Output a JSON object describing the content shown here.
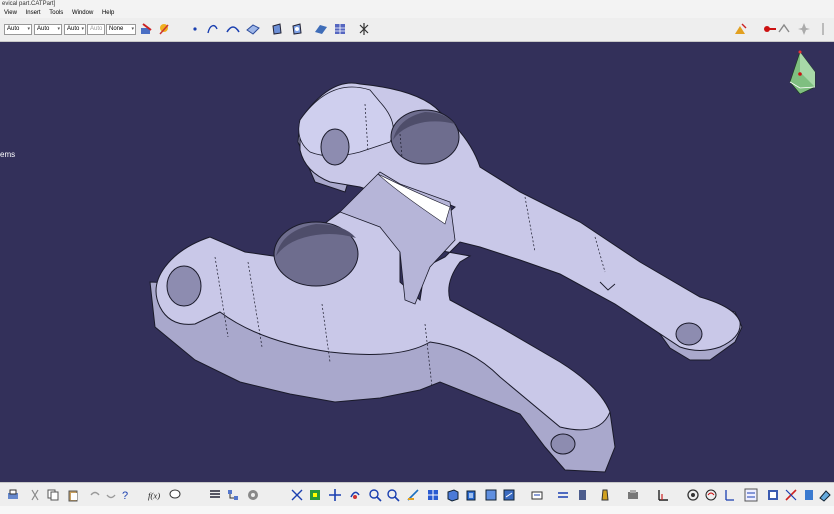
{
  "window": {
    "title": "evical part.CATPart]"
  },
  "menu": {
    "items": [
      "View",
      "Insert",
      "Tools",
      "Window",
      "Help"
    ]
  },
  "toolbar": {
    "combos": [
      {
        "name": "color-combo",
        "value": "Auto"
      },
      {
        "name": "linetype-combo",
        "value": "Auto"
      },
      {
        "name": "thickness-combo",
        "value": "Auto"
      },
      {
        "name": "point-combo",
        "value": "Auto"
      },
      {
        "name": "layer-combo",
        "value": "None"
      }
    ]
  },
  "tree": {
    "partial_label": "ems"
  },
  "colors": {
    "background": "#33305a",
    "part": "#c9c8e8",
    "toolbar": "#eeeeee"
  }
}
